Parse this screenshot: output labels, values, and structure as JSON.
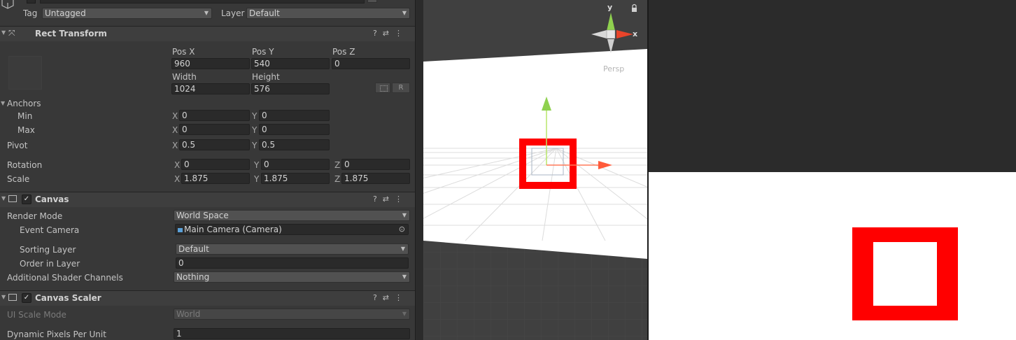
{
  "header": {
    "tag_label": "Tag",
    "tag_value": "Untagged",
    "layer_label": "Layer",
    "layer_value": "Default"
  },
  "rect_transform": {
    "title": "Rect Transform",
    "pos_x_label": "Pos X",
    "pos_x": "960",
    "pos_y_label": "Pos Y",
    "pos_y": "540",
    "pos_z_label": "Pos Z",
    "pos_z": "0",
    "width_label": "Width",
    "width": "1024",
    "height_label": "Height",
    "height": "576",
    "r_button": "R",
    "anchors_label": "Anchors",
    "min_label": "Min",
    "min_x": "0",
    "min_y": "0",
    "max_label": "Max",
    "max_x": "0",
    "max_y": "0",
    "pivot_label": "Pivot",
    "pivot_x": "0.5",
    "pivot_y": "0.5",
    "rotation_label": "Rotation",
    "rot_x": "0",
    "rot_y": "0",
    "rot_z": "0",
    "scale_label": "Scale",
    "scale_x": "1.875",
    "scale_y": "1.875",
    "scale_z": "1.875",
    "axis_x": "X",
    "axis_y": "Y",
    "axis_z": "Z"
  },
  "canvas": {
    "title": "Canvas",
    "render_mode_label": "Render Mode",
    "render_mode": "World Space",
    "event_camera_label": "Event Camera",
    "event_camera": "Main Camera (Camera)",
    "sorting_layer_label": "Sorting Layer",
    "sorting_layer": "Default",
    "order_label": "Order in Layer",
    "order": "0",
    "shader_channels_label": "Additional Shader Channels",
    "shader_channels": "Nothing"
  },
  "canvas_scaler": {
    "title": "Canvas Scaler",
    "ui_scale_mode_label": "UI Scale Mode",
    "ui_scale_mode": "World",
    "dpu_label": "Dynamic Pixels Per Unit",
    "dpu": "1"
  },
  "scene": {
    "gizmo_y": "y",
    "gizmo_x": "x",
    "persp_label": "Persp"
  },
  "colors": {
    "accent_red": "#ff0000",
    "inspector_bg": "#383838",
    "game_sky": "#2b2b2b"
  }
}
